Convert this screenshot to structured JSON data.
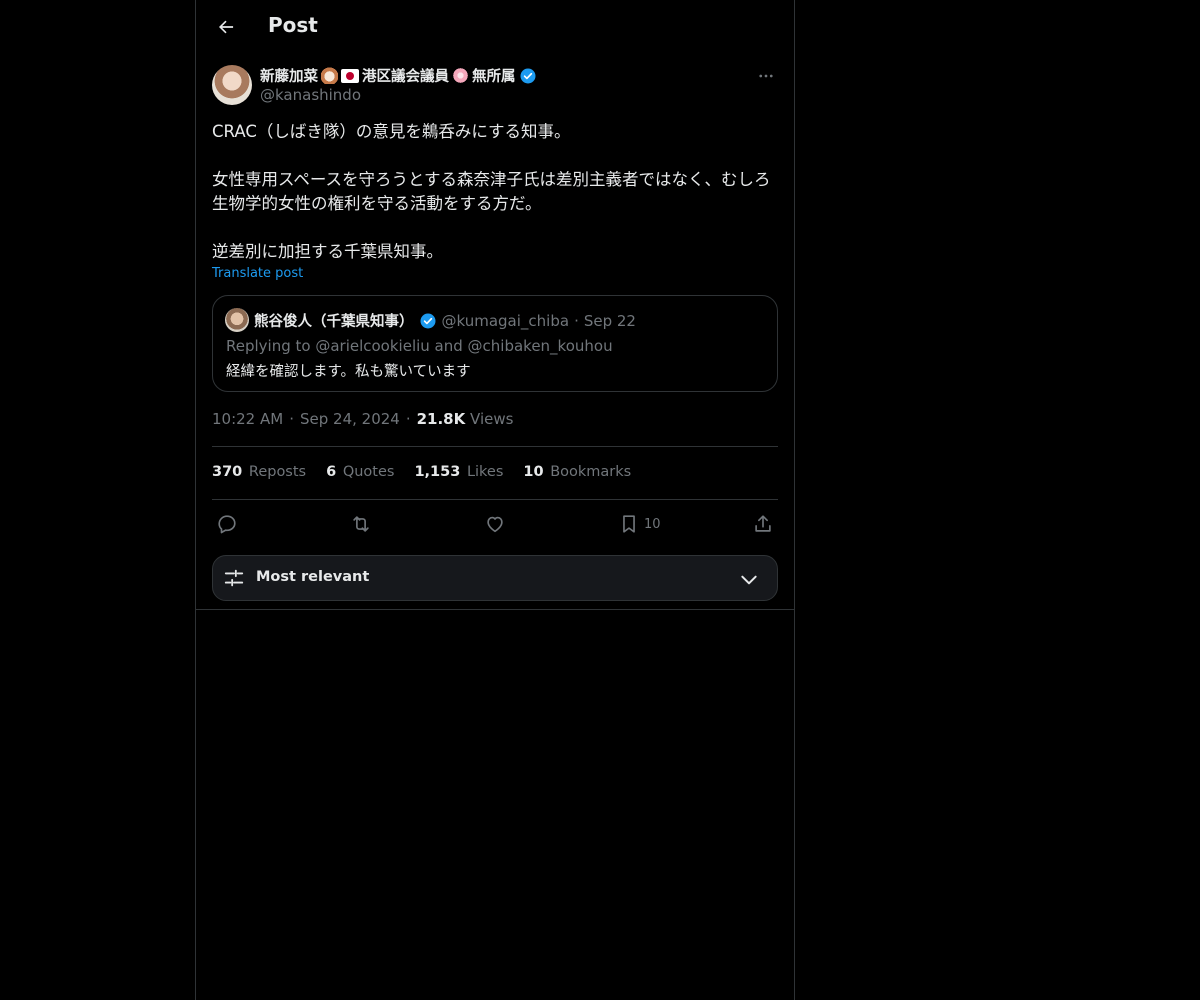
{
  "header": {
    "title": "Post"
  },
  "post": {
    "author": {
      "name_part1": "新藤加菜",
      "name_part2": "港区議会議員",
      "name_part3": "無所属",
      "handle": "@kanashindo",
      "verified": true
    },
    "text": "CRAC（しばき隊）の意見を鵜呑みにする知事。\n\n女性専用スペースを守ろうとする森奈津子氏は差別主義者ではなく、むしろ生物学的女性の権利を守る活動をする方だ。\n\n逆差別に加担する千葉県知事。",
    "translate_label": "Translate post",
    "quote": {
      "name": "熊谷俊人（千葉県知事）",
      "handle": "@kumagai_chiba",
      "separator": "·",
      "date": "Sep 22",
      "replying": "Replying to @arielcookieliu and @chibaken_kouhou",
      "text": "経緯を確認します。私も驚いています"
    },
    "meta": {
      "time": "10:22 AM",
      "sep1": "·",
      "date": "Sep 24, 2024",
      "sep2": "·",
      "views_count": "21.8K",
      "views_label": "Views"
    },
    "stats": {
      "reposts_count": "370",
      "reposts_label": "Reposts",
      "quotes_count": "6",
      "quotes_label": "Quotes",
      "likes_count": "1,153",
      "likes_label": "Likes",
      "bookmarks_count": "10",
      "bookmarks_label": "Bookmarks"
    },
    "actions": {
      "bookmark_count": "10"
    }
  },
  "replies_sort": {
    "label": "Most relevant"
  },
  "colors": {
    "background": "#000000",
    "text": "#e7e9ea",
    "muted": "#71767b",
    "accent": "#1d9bf0",
    "border": "#2f3336"
  }
}
